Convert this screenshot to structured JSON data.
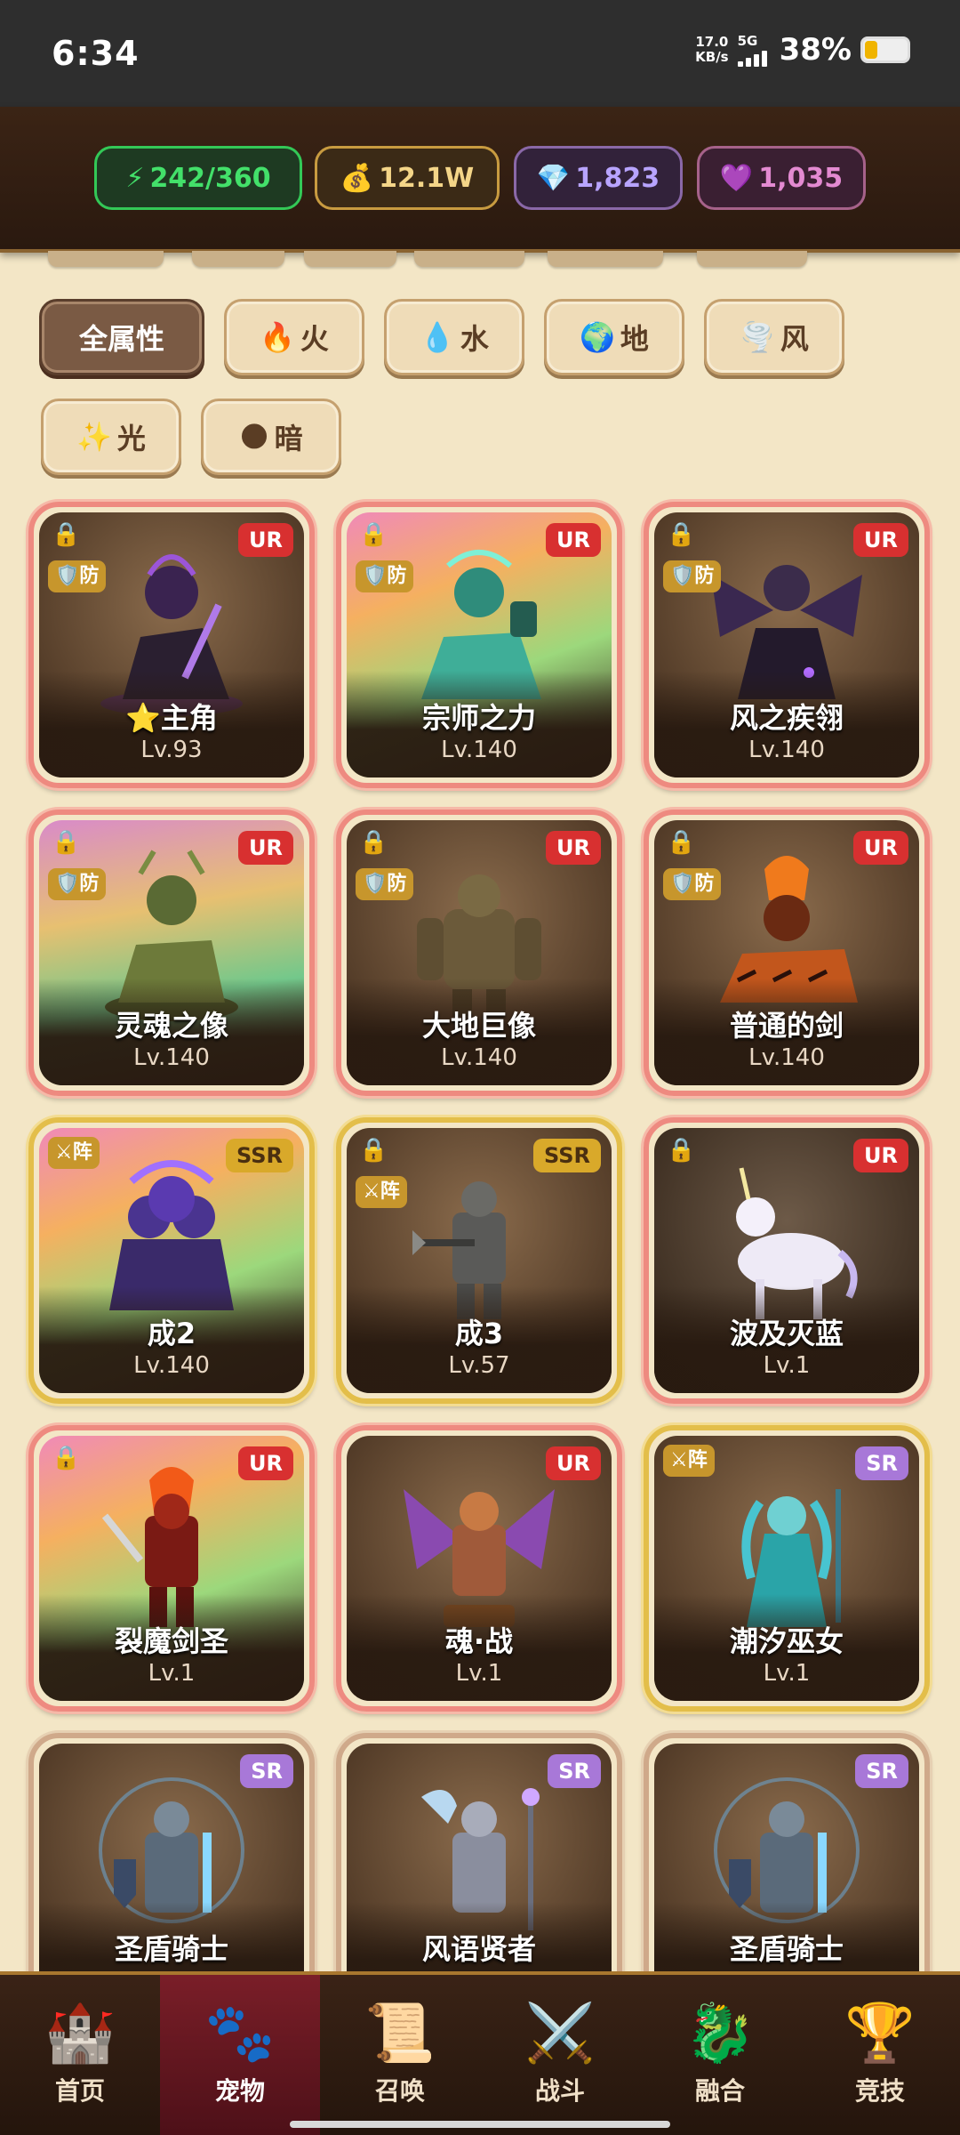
{
  "status": {
    "time": "6:34",
    "net_speed_value": "17.0",
    "net_speed_unit": "KB/s",
    "network": "5G",
    "battery": "38%"
  },
  "resources": {
    "energy": "242/360",
    "gold": "12.1W",
    "gems": "1,823",
    "hearts": "1,035"
  },
  "filters": [
    {
      "label": "全属性",
      "icon": ""
    },
    {
      "label": "火",
      "icon": "🔥"
    },
    {
      "label": "水",
      "icon": "💧"
    },
    {
      "label": "地",
      "icon": "🌍"
    },
    {
      "label": "风",
      "icon": "🌪️"
    },
    {
      "label": "光",
      "icon": "✨"
    },
    {
      "label": "暗",
      "icon": "🌑"
    }
  ],
  "pets": [
    {
      "name": "⭐主角",
      "level": "Lv.93",
      "rank": "UR",
      "tag": "🛡️防"
    },
    {
      "name": "宗师之力",
      "level": "Lv.140",
      "rank": "UR",
      "tag": "🛡️防"
    },
    {
      "name": "风之疾翎",
      "level": "Lv.140",
      "rank": "UR",
      "tag": "🛡️防"
    },
    {
      "name": "灵魂之像",
      "level": "Lv.140",
      "rank": "UR",
      "tag": "🛡️防"
    },
    {
      "name": "大地巨像",
      "level": "Lv.140",
      "rank": "UR",
      "tag": "🛡️防"
    },
    {
      "name": "普通的剑",
      "level": "Lv.140",
      "rank": "UR",
      "tag": "🛡️防"
    },
    {
      "name": "成2",
      "level": "Lv.140",
      "rank": "SSR",
      "tag": "⚔阵"
    },
    {
      "name": "成3",
      "level": "Lv.57",
      "rank": "SSR",
      "tag": "⚔阵"
    },
    {
      "name": "波及灭蓝",
      "level": "Lv.1",
      "rank": "UR",
      "tag": ""
    },
    {
      "name": "裂魔剑圣",
      "level": "Lv.1",
      "rank": "UR",
      "tag": ""
    },
    {
      "name": "魂·战",
      "level": "Lv.1",
      "rank": "UR",
      "tag": ""
    },
    {
      "name": "潮汐巫女",
      "level": "Lv.1",
      "rank": "SR",
      "tag": "⚔阵"
    },
    {
      "name": "圣盾骑士",
      "level": "",
      "rank": "SR",
      "tag": ""
    },
    {
      "name": "风语贤者",
      "level": "",
      "rank": "SR",
      "tag": ""
    },
    {
      "name": "圣盾骑士",
      "level": "",
      "rank": "SR",
      "tag": ""
    }
  ],
  "nav": [
    {
      "label": "首页",
      "icon": "🏰"
    },
    {
      "label": "宠物",
      "icon": "🐾"
    },
    {
      "label": "召唤",
      "icon": "📜"
    },
    {
      "label": "战斗",
      "icon": "⚔️"
    },
    {
      "label": "融合",
      "icon": "🐉"
    },
    {
      "label": "竞技",
      "icon": "🏆"
    }
  ],
  "colors": {
    "background": "#f3e6c6",
    "ur_border": "#ee8a80",
    "ssr_border": "#e3be4a",
    "sr_border": "#cfa98a",
    "nav_active": "#7a1e28"
  }
}
